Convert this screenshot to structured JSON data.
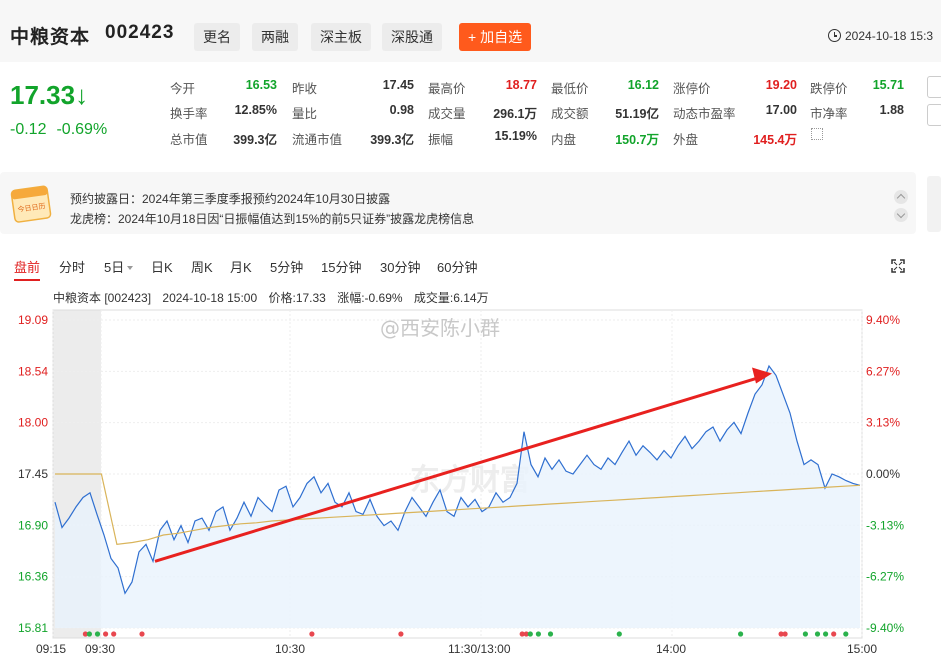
{
  "header": {
    "name": "中粮资本",
    "code": "002423",
    "tags": [
      "更名",
      "两融",
      "深主板",
      "深股通"
    ],
    "add_watch": "+ 加自选",
    "datetime": "2024-10-18 15:3"
  },
  "quote": {
    "price": "17.33",
    "arrow": "↓",
    "change": "-0.12",
    "change_pct": "-0.69%",
    "rows": [
      [
        [
          "今开",
          "16.53",
          "down"
        ],
        [
          "昨收",
          "17.45",
          "flat"
        ],
        [
          "最高价",
          "18.77",
          "up"
        ],
        [
          "最低价",
          "16.12",
          "down"
        ],
        [
          "涨停价",
          "19.20",
          "up"
        ],
        [
          "跌停价",
          "15.71",
          "down"
        ]
      ],
      [
        [
          "换手率",
          "12.85%",
          "flat"
        ],
        [
          "量比",
          "0.98",
          "flat"
        ],
        [
          "成交量",
          "296.1万",
          "flat"
        ],
        [
          "成交额",
          "51.19亿",
          "flat"
        ],
        [
          "动态市盈率",
          "17.00",
          "flat"
        ],
        [
          "市净率",
          "1.88",
          "flat"
        ]
      ],
      [
        [
          "总市值",
          "399.3亿",
          "flat"
        ],
        [
          "流通市值",
          "399.3亿",
          "flat"
        ],
        [
          "振幅",
          "15.19%",
          "flat"
        ],
        [
          "内盘",
          "150.7万",
          "down"
        ],
        [
          "外盘",
          "145.4万",
          "up"
        ]
      ]
    ]
  },
  "notice": {
    "icon_text": "今日日历",
    "line1": "预约披露日：2024年第三季度季报预约2024年10月30日披露",
    "line2": "龙虎榜：2024年10月18日因“日振幅值达到15%的前5只证券”披露龙虎榜信息"
  },
  "tabs": [
    "盘前",
    "分时",
    "5日",
    "日K",
    "周K",
    "月K",
    "5分钟",
    "15分钟",
    "30分钟",
    "60分钟"
  ],
  "active_tab": "盘前",
  "chart_info": {
    "title": "中粮资本 [002423]",
    "time": "2024-10-18 15:00",
    "price": "价格:17.33",
    "change": "涨幅:-0.69%",
    "volume": "成交量:6.14万"
  },
  "watermarks": [
    "@西安陈小群",
    "东方财富"
  ],
  "chart_data": {
    "type": "line",
    "x_labels": [
      "09:15",
      "09:30",
      "10:30",
      "11:30/13:00",
      "14:00",
      "15:00"
    ],
    "y_left_labels": [
      "19.09",
      "18.54",
      "18.00",
      "17.45",
      "16.90",
      "16.36",
      "15.81"
    ],
    "y_right_labels": [
      "9.40%",
      "6.27%",
      "3.13%",
      "0.00%",
      "-3.13%",
      "-6.27%",
      "-9.40%"
    ],
    "ylim": [
      15.81,
      19.09
    ],
    "prev_close": 17.45,
    "colors": {
      "price": "#2f6fd0",
      "avg": "#d9b45a",
      "up": "#e8474f",
      "down": "#2bb24c",
      "arrow": "#e8211f"
    },
    "series": [
      {
        "values": [
          17.15,
          16.88,
          16.98,
          17.1,
          17.2,
          17.25,
          17.02,
          16.8,
          16.55,
          16.45,
          16.18,
          16.3,
          16.62,
          16.7,
          16.52,
          16.85,
          16.95,
          16.75,
          16.9,
          16.72,
          16.95,
          16.98,
          16.85,
          17.05,
          17.1,
          16.85,
          16.98,
          17.15,
          17.0,
          17.2,
          17.12,
          17.05,
          17.28,
          17.32,
          17.1,
          17.2,
          17.35,
          17.42,
          17.25,
          17.35,
          17.15,
          17.1,
          17.25,
          17.05,
          17.02,
          17.18,
          17.0,
          16.9,
          16.95,
          16.85,
          17.05,
          17.2,
          17.1,
          17.0,
          17.15,
          17.28,
          17.05,
          17.0,
          17.2,
          17.1,
          17.18,
          17.05,
          17.1,
          17.25,
          17.15,
          17.2,
          17.35,
          17.9,
          17.55,
          17.42,
          17.62,
          17.5,
          17.6,
          17.48,
          17.45,
          17.55,
          17.65,
          17.55,
          17.5,
          17.62,
          17.55,
          17.68,
          17.8,
          17.65,
          17.75,
          17.68,
          17.6,
          17.7,
          17.62,
          17.75,
          17.85,
          17.72,
          17.8,
          17.9,
          17.95,
          17.8,
          17.92,
          18.0,
          17.88,
          18.1,
          18.3,
          18.4,
          18.6,
          18.5,
          18.3,
          18.1,
          17.8,
          17.55,
          17.6,
          17.55,
          17.3,
          17.45,
          17.42,
          17.38,
          17.35,
          17.33
        ],
        "avg": [
          17.45,
          17.45,
          17.45,
          17.45,
          16.7,
          16.72,
          16.75,
          16.8,
          16.82,
          16.85,
          16.88,
          16.9,
          16.92,
          16.93,
          16.95,
          16.96,
          16.97,
          16.98,
          16.99,
          17.0,
          17.01,
          17.02,
          17.03,
          17.04,
          17.05,
          17.06,
          17.07,
          17.08,
          17.09,
          17.1,
          17.11,
          17.12,
          17.13,
          17.14,
          17.15,
          17.16,
          17.17,
          17.18,
          17.19,
          17.2,
          17.21,
          17.22,
          17.23,
          17.24,
          17.25,
          17.26,
          17.27,
          17.28,
          17.29,
          17.3,
          17.31,
          17.32,
          17.33
        ],
        "avg_note": ""
      }
    ],
    "volume_marks": [
      {
        "t": 0.04,
        "c": "up"
      },
      {
        "t": 0.045,
        "c": "down"
      },
      {
        "t": 0.055,
        "c": "down"
      },
      {
        "t": 0.065,
        "c": "up"
      },
      {
        "t": 0.075,
        "c": "up"
      },
      {
        "t": 0.11,
        "c": "up"
      },
      {
        "t": 0.32,
        "c": "up"
      },
      {
        "t": 0.43,
        "c": "up"
      },
      {
        "t": 0.58,
        "c": "up"
      },
      {
        "t": 0.585,
        "c": "up"
      },
      {
        "t": 0.59,
        "c": "down"
      },
      {
        "t": 0.6,
        "c": "down"
      },
      {
        "t": 0.615,
        "c": "down"
      },
      {
        "t": 0.7,
        "c": "down"
      },
      {
        "t": 0.85,
        "c": "down"
      },
      {
        "t": 0.9,
        "c": "up"
      },
      {
        "t": 0.905,
        "c": "up"
      },
      {
        "t": 0.93,
        "c": "down"
      },
      {
        "t": 0.945,
        "c": "down"
      },
      {
        "t": 0.955,
        "c": "down"
      },
      {
        "t": 0.965,
        "c": "up"
      },
      {
        "t": 0.98,
        "c": "down"
      }
    ]
  }
}
